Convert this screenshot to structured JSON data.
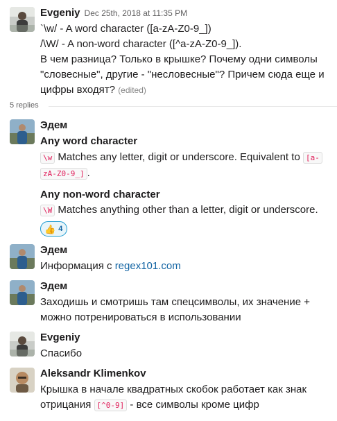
{
  "thread": {
    "parent": {
      "author": "Evgeniy",
      "timestamp": "Dec 25th, 2018 at 11:35 PM",
      "lines": [
        "`\\w/ - A word character ([a-zA-Z0-9_])",
        "/\\W/ - A non-word character ([^a-zA-Z0-9_]).",
        "В чем разница? Только в крышке? Почему одни символы",
        "\"словесные\", другие - \"несловесные\"? Причем сюда еще и",
        "цифры входят?"
      ],
      "edited": "(edited)"
    },
    "replies_label": "5 replies",
    "replies": [
      {
        "author": "Эдем",
        "heading1": "Any word character",
        "code1": "\\w",
        "text1a": "Matches any letter, digit or underscore. Equivalent to",
        "code2a": "[a-",
        "code2b": "zA-Z0-9_]",
        "text1b": ".",
        "heading2": "Any non-word character",
        "code3": "\\W",
        "text2": "Matches anything other than a letter, digit or underscore.",
        "reaction": {
          "emoji": "👍",
          "count": "4"
        }
      },
      {
        "author": "Эдем",
        "text_prefix": "Информация с",
        "link": "regex101.com"
      },
      {
        "author": "Эдем",
        "lines": [
          "Заходишь и смотришь там спецсимволы, их значение +",
          "можно потренироваться в использовании"
        ]
      },
      {
        "author": "Evgeniy",
        "text": "Спасибо"
      },
      {
        "author": "Aleksandr Klimenkov",
        "line1": "Крышка в начале квадратных скобок работает как знак",
        "line2_prefix": "отрицания",
        "code": "[^0-9]",
        "line2_suffix": "- все символы кроме цифр"
      }
    ]
  },
  "colors": {
    "text": "#1d1c1d",
    "muted": "#616061",
    "link": "#1264a3",
    "code": "#e01e5a",
    "reaction_border": "#1d9bd1",
    "reaction_bg": "#e8f5fa"
  }
}
